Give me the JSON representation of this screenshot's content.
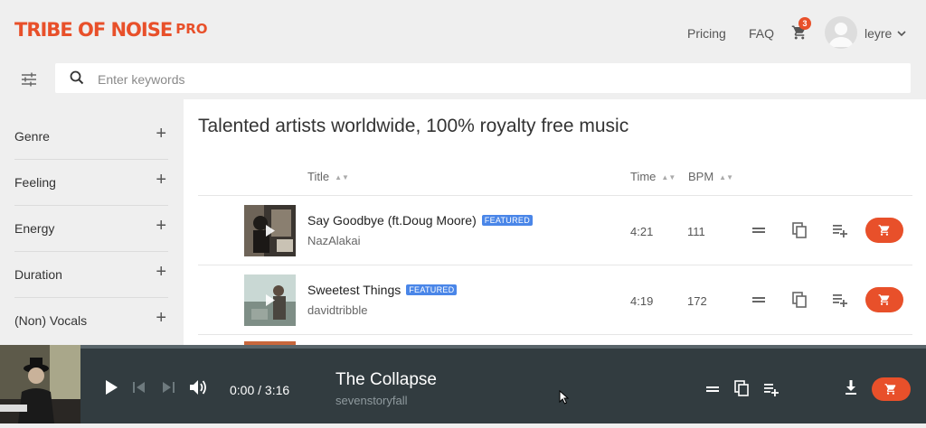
{
  "header": {
    "logo_main": "TRIBE OF NOISE",
    "logo_pro": "PRO",
    "nav": [
      "Pricing",
      "FAQ"
    ],
    "cart_count": "3",
    "username": "leyre"
  },
  "search": {
    "placeholder": "Enter keywords",
    "value": ""
  },
  "sidebar": {
    "filters": [
      "Genre",
      "Feeling",
      "Energy",
      "Duration",
      "(Non) Vocals"
    ]
  },
  "main": {
    "heading": "Talented artists worldwide, 100% royalty free music",
    "columns": {
      "title": "Title",
      "time": "Time",
      "bpm": "BPM"
    },
    "tracks": [
      {
        "title": "Say Goodbye (ft.Doug Moore)",
        "badge": "FEATURED",
        "artist": "NazAlakai",
        "time": "4:21",
        "bpm": "111"
      },
      {
        "title": "Sweetest Things",
        "badge": "FEATURED",
        "artist": "davidtribble",
        "time": "4:19",
        "bpm": "172"
      }
    ]
  },
  "player": {
    "time_display": "0:00 / 3:16",
    "title": "The Collapse",
    "artist": "sevenstoryfall",
    "progress": 0
  },
  "colors": {
    "accent": "#e8502a",
    "badge": "#4a86e8",
    "player_bg": "#323c40",
    "page_bg": "#efefef"
  },
  "icons": [
    "filter-sliders-icon",
    "search-icon",
    "cart-icon",
    "chevron-down-icon",
    "plus-icon",
    "play-icon",
    "skip-previous-icon",
    "skip-next-icon",
    "volume-icon",
    "download-icon",
    "equal-icon",
    "copy-icon",
    "add-to-playlist-icon",
    "sort-icon"
  ]
}
